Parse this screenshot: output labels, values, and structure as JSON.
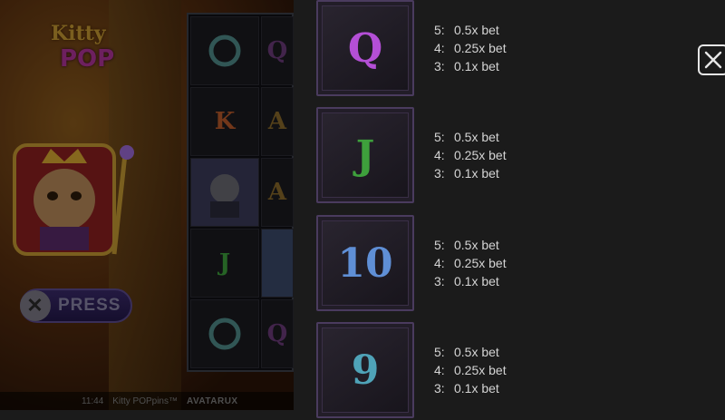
{
  "game": {
    "logo_line1": "Kitty",
    "logo_line2": "POP",
    "press_label": "PRESS",
    "reel_symbols": [
      "o",
      "K",
      "cat",
      "J",
      "o"
    ],
    "status": {
      "time": "11:44",
      "title": "Kitty POPpins™",
      "brand": "AVATARUX"
    }
  },
  "paytable": {
    "rows": [
      {
        "symbol": "Q",
        "symbol_color": "#b44fd6",
        "payouts": [
          {
            "count": "5:",
            "value": "0.5x bet"
          },
          {
            "count": "4:",
            "value": "0.25x bet"
          },
          {
            "count": "3:",
            "value": "0.1x bet"
          }
        ]
      },
      {
        "symbol": "J",
        "symbol_color": "#3ea03c",
        "payouts": [
          {
            "count": "5:",
            "value": "0.5x bet"
          },
          {
            "count": "4:",
            "value": "0.25x bet"
          },
          {
            "count": "3:",
            "value": "0.1x bet"
          }
        ]
      },
      {
        "symbol": "10",
        "symbol_color": "#5f8fd6",
        "payouts": [
          {
            "count": "5:",
            "value": "0.5x bet"
          },
          {
            "count": "4:",
            "value": "0.25x bet"
          },
          {
            "count": "3:",
            "value": "0.1x bet"
          }
        ]
      },
      {
        "symbol": "9",
        "symbol_color": "#4fa3b8",
        "payouts": [
          {
            "count": "5:",
            "value": "0.5x bet"
          },
          {
            "count": "4:",
            "value": "0.25x bet"
          },
          {
            "count": "3:",
            "value": "0.1x bet"
          }
        ]
      }
    ]
  },
  "close": {
    "icon": "close-icon",
    "color": "#e6e6e6"
  }
}
